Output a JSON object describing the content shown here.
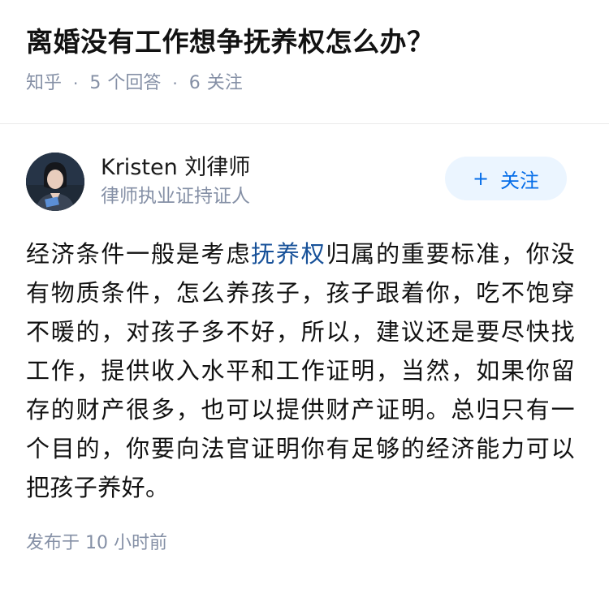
{
  "question": {
    "title": "离婚没有工作想争抚养权怎么办？",
    "source": "知乎",
    "answer_count": "5",
    "answer_label": "个回答",
    "follower_count": "6",
    "follower_label": "关注"
  },
  "author": {
    "name": "Kristen 刘律师",
    "bio": "律师执业证持证人",
    "follow_icon": "+",
    "follow_label": "关注"
  },
  "answer": {
    "text_before_link": "经济条件一般是考虑",
    "link_text": "抚养权",
    "text_after_link": "归属的重要标准，你没有物质条件，怎么养孩子，孩子跟着你，吃不饱穿不暖的，对孩子多不好，所以，建议还是要尽快找工作，提供收入水平和工作证明，当然，如果你留存的财产很多，也可以提供财产证明。总归只有一个目的，你要向法官证明你有足够的经济能力可以把孩子养好。",
    "publish_prefix": "发布于",
    "publish_time": "10 小时前"
  },
  "colors": {
    "accent": "#056de8",
    "follow_bg": "#ebf5ff",
    "meta_gray": "#8590a6",
    "link": "#175199"
  }
}
